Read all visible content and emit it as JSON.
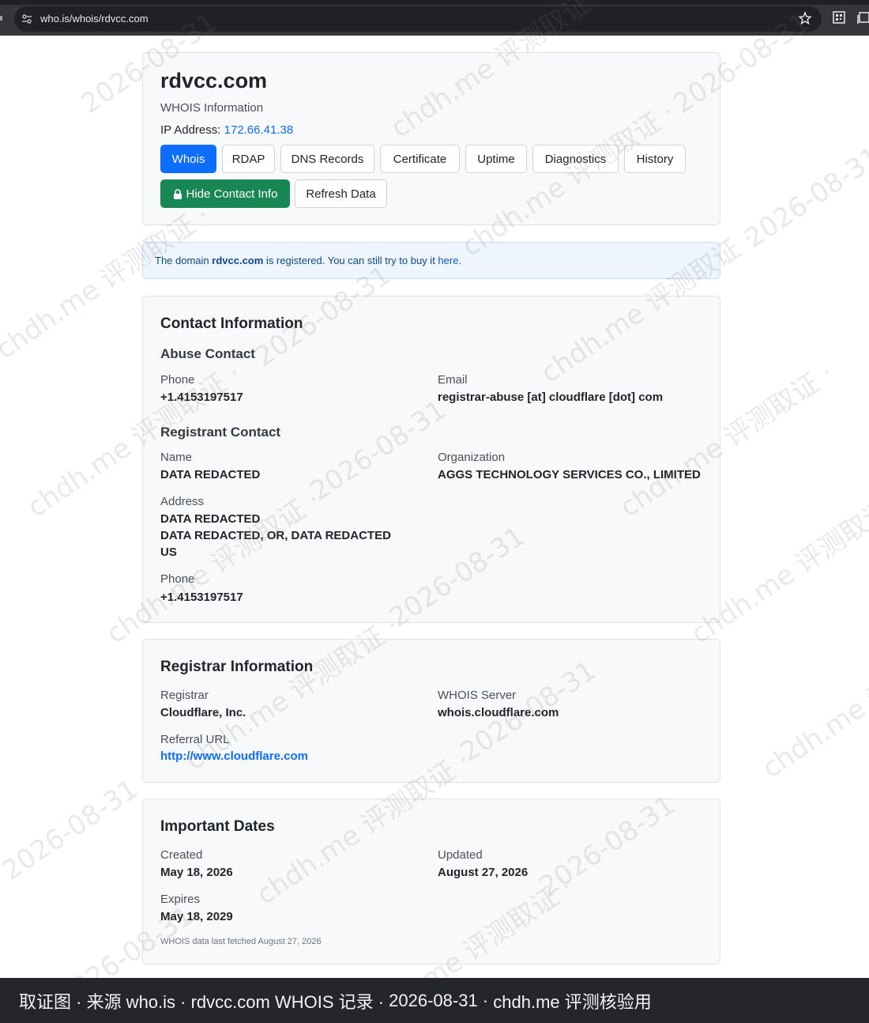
{
  "browser": {
    "url": "who.is/whois/rdvcc.com"
  },
  "header": {
    "domain": "rdvcc.com",
    "subtitle": "WHOIS Information",
    "ip_label": "IP Address:",
    "ip_value": "172.66.41.38",
    "tabs": [
      "Whois",
      "RDAP",
      "DNS Records",
      "Certificate",
      "Uptime",
      "Diagnostics",
      "History"
    ],
    "active_tab": "Whois",
    "hide_contact_label": "Hide Contact Info",
    "refresh_label": "Refresh Data"
  },
  "alert": {
    "prefix": "The domain ",
    "domain": "rdvcc.com",
    "middle": " is registered. You can still try to buy it ",
    "link": "here",
    "suffix": "."
  },
  "contact": {
    "title": "Contact Information",
    "abuse": {
      "title": "Abuse Contact",
      "phone_label": "Phone",
      "phone_value": "+1.4153197517",
      "email_label": "Email",
      "email_value": "registrar-abuse [at] cloudflare [dot] com"
    },
    "registrant": {
      "title": "Registrant Contact",
      "name_label": "Name",
      "name_value": "DATA REDACTED",
      "org_label": "Organization",
      "org_value": "AGGS TECHNOLOGY SERVICES CO., LIMITED",
      "address_label": "Address",
      "address_lines": [
        "DATA REDACTED",
        "DATA REDACTED, OR, DATA REDACTED",
        "US"
      ],
      "phone_label": "Phone",
      "phone_value": "+1.4153197517"
    }
  },
  "registrar": {
    "title": "Registrar Information",
    "registrar_label": "Registrar",
    "registrar_value": "Cloudflare, Inc.",
    "server_label": "WHOIS Server",
    "server_value": "whois.cloudflare.com",
    "referral_label": "Referral URL",
    "referral_value": "http://www.cloudflare.com"
  },
  "dates": {
    "title": "Important Dates",
    "created_label": "Created",
    "created_value": "May 18, 2026",
    "updated_label": "Updated",
    "updated_value": "August 27, 2026",
    "expires_label": "Expires",
    "expires_value": "May 18, 2029",
    "fetched": "WHOIS data last fetched August 27, 2026"
  },
  "footer": {
    "items": [
      "取证图 · ",
      "来源 who.is · ",
      "rdvcc.com WHOIS 记录 · ",
      "2026-08-31 · ",
      "chdh.me 评测核验用"
    ]
  },
  "watermark": {
    "site": "chdh.me 评测取证 ·",
    "date": "2026-08-31"
  },
  "colors": {
    "primary": "#0d6efd",
    "success": "#198754",
    "card_bg": "#f8f9fa",
    "alert_bg": "#eef5fe"
  }
}
